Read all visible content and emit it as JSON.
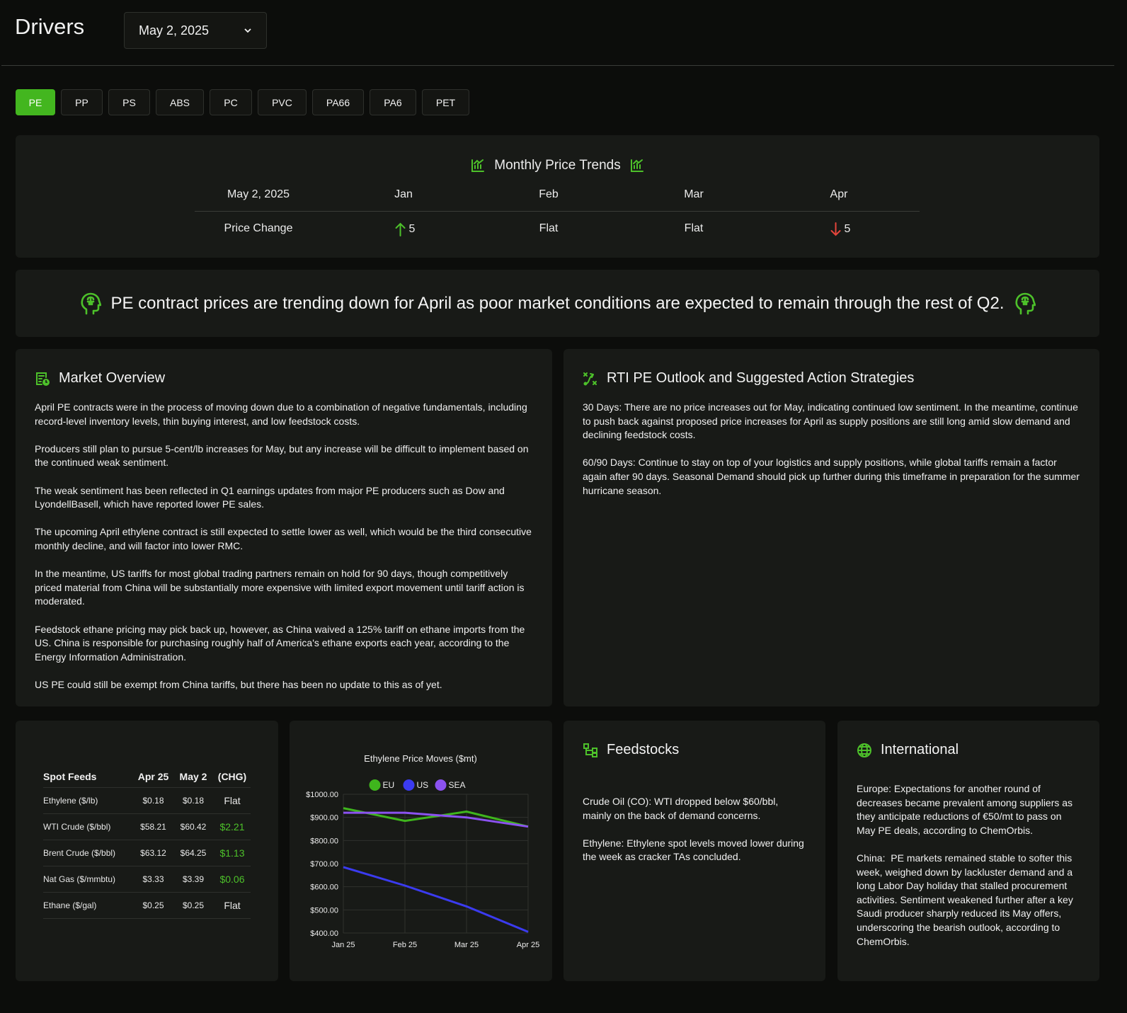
{
  "header": {
    "title": "Drivers",
    "date_select": "May 2, 2025"
  },
  "tabs": [
    {
      "label": "PE",
      "active": true
    },
    {
      "label": "PP"
    },
    {
      "label": "PS"
    },
    {
      "label": "ABS"
    },
    {
      "label": "PC"
    },
    {
      "label": "PVC"
    },
    {
      "label": "PA66"
    },
    {
      "label": "PA6"
    },
    {
      "label": "PET"
    }
  ],
  "trends": {
    "title": "Monthly Price Trends",
    "date_label": "May 2, 2025",
    "row_label": "Price Change",
    "months": [
      "Jan",
      "Feb",
      "Mar",
      "Apr"
    ],
    "changes": [
      {
        "text": "5",
        "direction": "up"
      },
      {
        "text": "Flat",
        "direction": "flat"
      },
      {
        "text": "Flat",
        "direction": "flat"
      },
      {
        "text": "5",
        "direction": "down"
      }
    ]
  },
  "banner": {
    "text": "PE contract prices are trending down for April as poor market conditions are expected to remain through the rest of Q2."
  },
  "overview": {
    "title": "Market Overview",
    "paragraphs": [
      "April PE contracts were in the process of moving down due to a combination of negative fundamentals, including record-level inventory levels, thin buying interest, and low feedstock costs.",
      "Producers still plan to pursue 5-cent/lb increases for May, but any increase will be difficult to implement based on the continued weak sentiment.",
      "The weak sentiment has been reflected in Q1 earnings updates from major PE producers such as Dow and LyondellBasell, which have reported lower PE sales.",
      "The upcoming April ethylene contract is still expected to settle lower as well, which would be the third consecutive monthly decline, and will factor into lower RMC.",
      "In the meantime, US tariffs for most global trading partners remain on hold for 90 days, though competitively priced material from China will be substantially more expensive with limited export movement until tariff action is moderated.",
      "Feedstock ethane pricing may pick back up, however, as China waived a 125% tariff on ethane imports from the US. China is responsible for purchasing roughly half of America's ethane exports each year, according to the Energy Information Administration.",
      "US PE could still be exempt from China tariffs, but there has been no update to this as of yet."
    ]
  },
  "outlook": {
    "title": "RTI PE Outlook and Suggested Action Strategies",
    "paragraphs": [
      "30 Days: There are no price increases out for May, indicating continued low sentiment. In the meantime, continue to push back against proposed price increases for April as supply positions are still long amid slow demand and declining feedstock costs.",
      "60/90 Days: Continue to stay on top of your logistics and supply positions, while global tariffs remain a factor again after 90 days. Seasonal Demand should pick up further during this timeframe in preparation for the summer hurricane season."
    ]
  },
  "spot_feeds": {
    "headers": [
      "Spot Feeds",
      "Apr 25",
      "May 2",
      "(CHG)"
    ],
    "rows": [
      {
        "name": "Ethylene ($/lb)",
        "apr": "$0.18",
        "may": "$0.18",
        "chg": "Flat",
        "positive": false
      },
      {
        "name": "WTI Crude ($/bbl)",
        "apr": "$58.21",
        "may": "$60.42",
        "chg": "$2.21",
        "positive": true
      },
      {
        "name": "Brent Crude ($/bbl)",
        "apr": "$63.12",
        "may": "$64.25",
        "chg": "$1.13",
        "positive": true
      },
      {
        "name": "Nat Gas ($/mmbtu)",
        "apr": "$3.33",
        "may": "$3.39",
        "chg": "$0.06",
        "positive": true
      },
      {
        "name": "Ethane ($/gal)",
        "apr": "$0.25",
        "may": "$0.25",
        "chg": "Flat",
        "positive": false
      }
    ]
  },
  "chart_data": {
    "type": "line",
    "title": "Ethylene Price Moves ($mt)",
    "categories": [
      "Jan 25",
      "Feb 25",
      "Mar 25",
      "Apr 25"
    ],
    "series": [
      {
        "name": "EU",
        "color": "#3fb51d",
        "values": [
          940,
          885,
          925,
          860
        ]
      },
      {
        "name": "US",
        "color": "#3b3bf0",
        "values": [
          685,
          605,
          515,
          405
        ]
      },
      {
        "name": "SEA",
        "color": "#8b52f0",
        "values": [
          920,
          920,
          900,
          860
        ]
      }
    ],
    "ylim": [
      400,
      1000
    ],
    "yticks": [
      "$1000.00",
      "$900.00",
      "$800.00",
      "$700.00",
      "$600.00",
      "$500.00",
      "$400.00"
    ],
    "ytick_values": [
      1000,
      900,
      800,
      700,
      600,
      500,
      400
    ],
    "grid": true,
    "legend": "top"
  },
  "feedstocks": {
    "title": "Feedstocks",
    "paragraphs": [
      "Crude Oil (CO): WTI dropped below $60/bbl, mainly on the back of demand concerns.",
      "Ethylene: Ethylene spot levels moved lower during the week as cracker TAs concluded."
    ]
  },
  "international": {
    "title": "International",
    "paragraphs": [
      "Europe: Expectations for another round of decreases became prevalent among suppliers as they anticipate reductions of €50/mt to pass on May PE deals, according to ChemOrbis.",
      "China:  PE markets remained stable to softer this week, weighed down by lackluster demand and a long Labor Day holiday that stalled procurement activities. Sentiment weakened further after a key Saudi producer sharply reduced its May offers, underscoring the bearish outlook, according to ChemOrbis."
    ]
  },
  "colors": {
    "accent": "#43b61f",
    "up": "#4dc12a",
    "down": "#e5453b",
    "card": "#181a17",
    "background": "#0c0d0b"
  }
}
